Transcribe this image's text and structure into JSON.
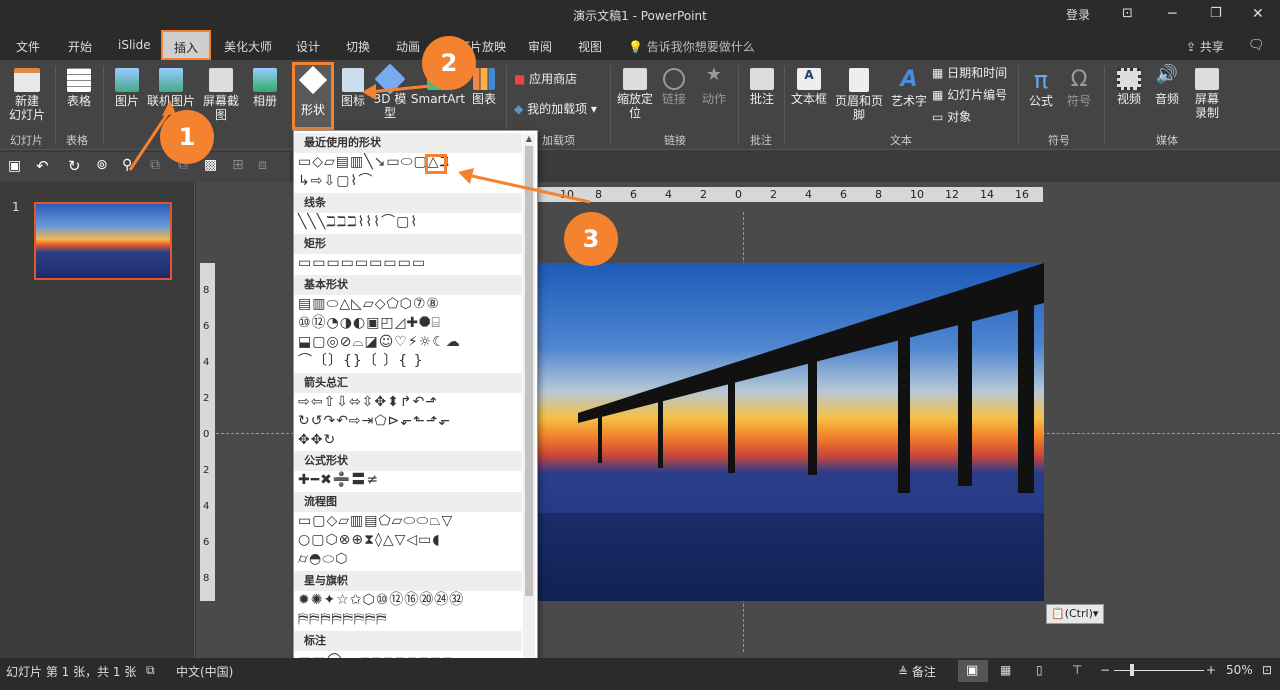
{
  "title_bar": {
    "title": "演示文稿1  -  PowerPoint",
    "login": "登录"
  },
  "tabs": [
    "文件",
    "开始",
    "iSlide",
    "插入",
    "美化大师",
    "设计",
    "切换",
    "动画",
    "幻灯片放映",
    "审阅",
    "视图"
  ],
  "tell_me": "告诉我你想要做什么",
  "share": "共享",
  "ribbon": {
    "new_slide": "新建\n幻灯片",
    "group_slides": "幻灯片",
    "table": "表格",
    "group_table": "表格",
    "picture": "图片",
    "online_picture": "联机图片",
    "screenshot": "屏幕截图",
    "album": "相册",
    "shapes": "形状",
    "icons": "图标",
    "model3d": "3D 模\n型",
    "smartart": "SmartArt",
    "chart": "图表",
    "app_store": "应用商店",
    "my_addins": "我的加载项",
    "group_addins": "加载项",
    "zoom": "缩放定\n位",
    "link": "链接",
    "action": "动作",
    "group_links": "链接",
    "comment": "批注",
    "group_comments": "批注",
    "textbox": "文本框",
    "header_footer": "页眉和页脚",
    "wordart": "艺术字",
    "datetime": "日期和时间",
    "slide_number": "幻灯片编号",
    "object": "对象",
    "group_text": "文本",
    "equation": "公式",
    "symbol": "符号",
    "group_symbols": "符号",
    "video": "视频",
    "audio": "音频",
    "screen_record": "屏幕\n录制",
    "group_media": "媒体"
  },
  "shapes_menu": {
    "sections": [
      {
        "label": "最近使用的形状",
        "glyphs": "▭◇▱▤▥╲↘▭⬭▢△ℶ\n↳⇨⇩▢⌇⌒"
      },
      {
        "label": "线条",
        "glyphs": "╲╲╲ℶℶℶ⌇⌇⌇⌒▢⌇"
      },
      {
        "label": "矩形",
        "glyphs": "▭▭▭▭▭▭▭▭▭"
      },
      {
        "label": "基本形状",
        "glyphs": "▤▥⬭△◺▱◇⬠⬡⑦⑧\n⑩⑫◔◑◐▣◰◿✚⯃⌸\n⬓▢◎⊘⌓◪☺♡⚡☼☾☁\n⌒〔〕{}〔 〕{ }"
      },
      {
        "label": "箭头总汇",
        "glyphs": "⇨⇦⇧⇩⬄⇳✥⬍↱↶⬏\n↻↺↷↶⇨⇥⬠⊳⬐⬑⬏⬐\n✥✥↻"
      },
      {
        "label": "公式形状",
        "glyphs": "✚━✖➗〓≠"
      },
      {
        "label": "流程图",
        "glyphs": "▭▢◇▱▥▤⬠▱⬭⬭⏢▽\n○▢⬡⊗⊕⧗◊△▽◁▭◖\n⌭◓⬭⬡"
      },
      {
        "label": "星与旗帜",
        "glyphs": "✹✺✦☆✩⬡⑩⑫⑯⑳㉔㉜\n⛿⛿⛿⛿⛿⛿⛿⛿"
      },
      {
        "label": "标注",
        "glyphs": "▭▭◯☁▱▱▱▱▱▱▱▱"
      }
    ]
  },
  "slide_panel": {
    "number": "1"
  },
  "ruler_h": [
    "10",
    "8",
    "6",
    "4",
    "2",
    "0",
    "2",
    "4",
    "6",
    "8",
    "10",
    "12",
    "14",
    "16"
  ],
  "ruler_v": [
    "8",
    "6",
    "4",
    "2",
    "0",
    "2",
    "4",
    "6",
    "8"
  ],
  "paste_tag": "(Ctrl)",
  "annotations": [
    "1",
    "2",
    "3"
  ],
  "status_bar": {
    "slide_info": "幻灯片 第 1 张，共 1 张",
    "language": "中文(中国)",
    "notes": "备注",
    "zoom": "50%"
  },
  "colors": {
    "accent": "#f4822f",
    "selected_tab": "#cfcfcf"
  }
}
